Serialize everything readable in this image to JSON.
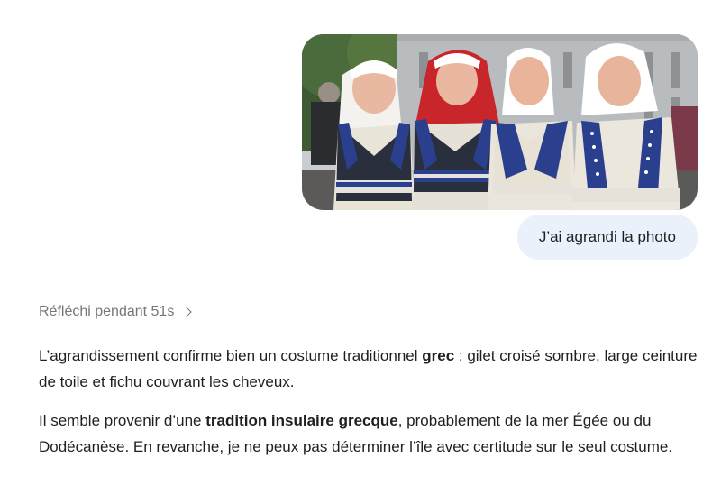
{
  "conversation": {
    "user_message": {
      "photo_alt": "four dancers in traditional costume",
      "text": "J’ai agrandi la photo"
    },
    "assistant": {
      "thinking_label": "Réfléchi pendant 51s",
      "paragraph1": {
        "before": "L’agrandissement confirme bien un costume traditionnel ",
        "bold": "grec",
        "after": " : gilet croisé sombre, large ceinture de toile et fichu couvrant les cheveux."
      },
      "paragraph2": {
        "before": "Il semble provenir d’une ",
        "bold": "tradition insulaire grecque",
        "after": ", probablement de la mer Égée ou du Dodécanèse. En revanche, je ne peux pas déterminer l’île avec certitude sur le seul costume."
      }
    }
  },
  "colors": {
    "user_bubble": "#eaf1fb",
    "muted_text": "#767676",
    "vest_blue": "#2b3f8f",
    "vest_dark": "#2a2f3e",
    "red_scarf": "#c8262b"
  }
}
